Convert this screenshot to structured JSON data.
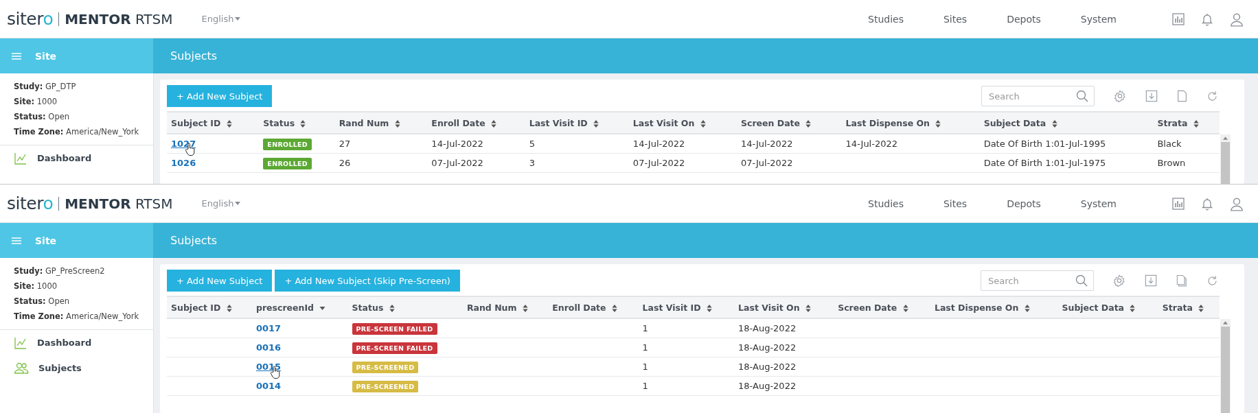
{
  "screens": [
    {
      "brand": {
        "name": "sitero",
        "product": "MENTOR",
        "suffix": "RTSM"
      },
      "language": "English",
      "nav": [
        "Studies",
        "Sites",
        "Depots",
        "System"
      ],
      "sidebar": {
        "title": "Site",
        "info": [
          {
            "label": "Study:",
            "value": "GP_DTP"
          },
          {
            "label": "Site:",
            "value": "1000"
          },
          {
            "label": "Status:",
            "value": "Open"
          },
          {
            "label": "Time Zone:",
            "value": "America/New_York"
          }
        ],
        "items": [
          {
            "kind": "dashboard",
            "label": "Dashboard"
          }
        ]
      },
      "page_title": "Subjects",
      "buttons": [
        "+ Add New Subject"
      ],
      "search": {
        "placeholder": "Search"
      },
      "toolbar_icons": [
        {
          "kind": "settings"
        },
        {
          "kind": "download"
        },
        {
          "kind": "document"
        },
        {
          "kind": "refresh"
        }
      ],
      "table": {
        "columns": [
          {
            "label": "Subject ID",
            "kind": "sortable"
          },
          {
            "label": "Status",
            "kind": "sortable"
          },
          {
            "label": "Rand Num",
            "kind": "sortable"
          },
          {
            "label": "Enroll Date",
            "kind": "sortable"
          },
          {
            "label": "Last Visit ID",
            "kind": "sortable"
          },
          {
            "label": "Last Visit On",
            "kind": "sortable"
          },
          {
            "label": "Screen Date",
            "kind": "sortable"
          },
          {
            "label": "Last Dispense On",
            "kind": "sortable"
          },
          {
            "label": "Subject Data",
            "kind": "sortable"
          },
          {
            "label": "Strata",
            "kind": "sortable"
          }
        ],
        "rows": [
          [
            {
              "kind": "link",
              "text": "1027",
              "hovered": true
            },
            {
              "kind": "badge",
              "text": "ENROLLED",
              "color": "#5ba833"
            },
            {
              "kind": "text",
              "text": "27"
            },
            {
              "kind": "text",
              "text": "14-Jul-2022"
            },
            {
              "kind": "text",
              "text": "5"
            },
            {
              "kind": "text",
              "text": "14-Jul-2022"
            },
            {
              "kind": "text",
              "text": "14-Jul-2022"
            },
            {
              "kind": "text",
              "text": "14-Jul-2022"
            },
            {
              "kind": "text",
              "text": "Date Of Birth 1:01-Jul-1995"
            },
            {
              "kind": "text",
              "text": "Black"
            }
          ],
          [
            {
              "kind": "link",
              "text": "1026",
              "hovered": false
            },
            {
              "kind": "badge",
              "text": "ENROLLED",
              "color": "#5ba833"
            },
            {
              "kind": "text",
              "text": "26"
            },
            {
              "kind": "text",
              "text": "07-Jul-2022"
            },
            {
              "kind": "text",
              "text": "3"
            },
            {
              "kind": "text",
              "text": "07-Jul-2022"
            },
            {
              "kind": "text",
              "text": "07-Jul-2022"
            },
            null,
            {
              "kind": "text",
              "text": "Date Of Birth 1:01-Jul-1975"
            },
            {
              "kind": "text",
              "text": "Brown"
            }
          ]
        ]
      }
    },
    {
      "brand": {
        "name": "sitero",
        "product": "MENTOR",
        "suffix": "RTSM"
      },
      "language": "English",
      "nav": [
        "Studies",
        "Sites",
        "Depots",
        "System"
      ],
      "sidebar": {
        "title": "Site",
        "info": [
          {
            "label": "Study:",
            "value": "GP_PreScreen2"
          },
          {
            "label": "Site:",
            "value": "1000"
          },
          {
            "label": "Status:",
            "value": "Open"
          },
          {
            "label": "Time Zone:",
            "value": "America/New_York"
          }
        ],
        "items": [
          {
            "kind": "dashboard",
            "label": "Dashboard"
          },
          {
            "kind": "subjects",
            "label": "Subjects"
          }
        ]
      },
      "page_title": "Subjects",
      "buttons": [
        "+ Add New Subject",
        "+ Add New Subject (Skip Pre-Screen)"
      ],
      "search": {
        "placeholder": "Search"
      },
      "toolbar_icons": [
        {
          "kind": "settings"
        },
        {
          "kind": "download"
        },
        {
          "kind": "copies"
        },
        {
          "kind": "refresh"
        }
      ],
      "table": {
        "columns": [
          {
            "label": "Subject ID",
            "kind": "sortable"
          },
          {
            "label": "prescreenId",
            "kind": "sorted_desc"
          },
          {
            "label": "Status",
            "kind": "sortable"
          },
          {
            "label": "Rand Num",
            "kind": "sortable"
          },
          {
            "label": "Enroll Date",
            "kind": "sortable"
          },
          {
            "label": "Last Visit ID",
            "kind": "sortable"
          },
          {
            "label": "Last Visit On",
            "kind": "sortable"
          },
          {
            "label": "Screen Date",
            "kind": "sortable"
          },
          {
            "label": "Last Dispense On",
            "kind": "sortable"
          },
          {
            "label": "Subject Data",
            "kind": "sortable"
          },
          {
            "label": "Strata",
            "kind": "sortable"
          }
        ],
        "rows": [
          [
            null,
            {
              "kind": "link",
              "text": "0017",
              "hovered": false
            },
            {
              "kind": "badge",
              "text": "PRE-SCREEN FAILED",
              "color": "#c9353b"
            },
            null,
            null,
            {
              "kind": "text",
              "text": "1"
            },
            {
              "kind": "text",
              "text": "18-Aug-2022"
            },
            null,
            null,
            null,
            null
          ],
          [
            null,
            {
              "kind": "link",
              "text": "0016",
              "hovered": false
            },
            {
              "kind": "badge",
              "text": "PRE-SCREEN FAILED",
              "color": "#c9353b"
            },
            null,
            null,
            {
              "kind": "text",
              "text": "1"
            },
            {
              "kind": "text",
              "text": "18-Aug-2022"
            },
            null,
            null,
            null,
            null
          ],
          [
            null,
            {
              "kind": "link",
              "text": "0015",
              "hovered": true
            },
            {
              "kind": "badge",
              "text": "PRE-SCREENED",
              "color": "#d6bb45"
            },
            null,
            null,
            {
              "kind": "text",
              "text": "1"
            },
            {
              "kind": "text",
              "text": "18-Aug-2022"
            },
            null,
            null,
            null,
            null
          ],
          [
            null,
            {
              "kind": "link",
              "text": "0014",
              "hovered": false
            },
            {
              "kind": "badge",
              "text": "PRE-SCREENED",
              "color": "#d6bb45"
            },
            null,
            null,
            {
              "kind": "text",
              "text": "1"
            },
            {
              "kind": "text",
              "text": "18-Aug-2022"
            },
            null,
            null,
            null,
            null
          ]
        ]
      }
    }
  ]
}
